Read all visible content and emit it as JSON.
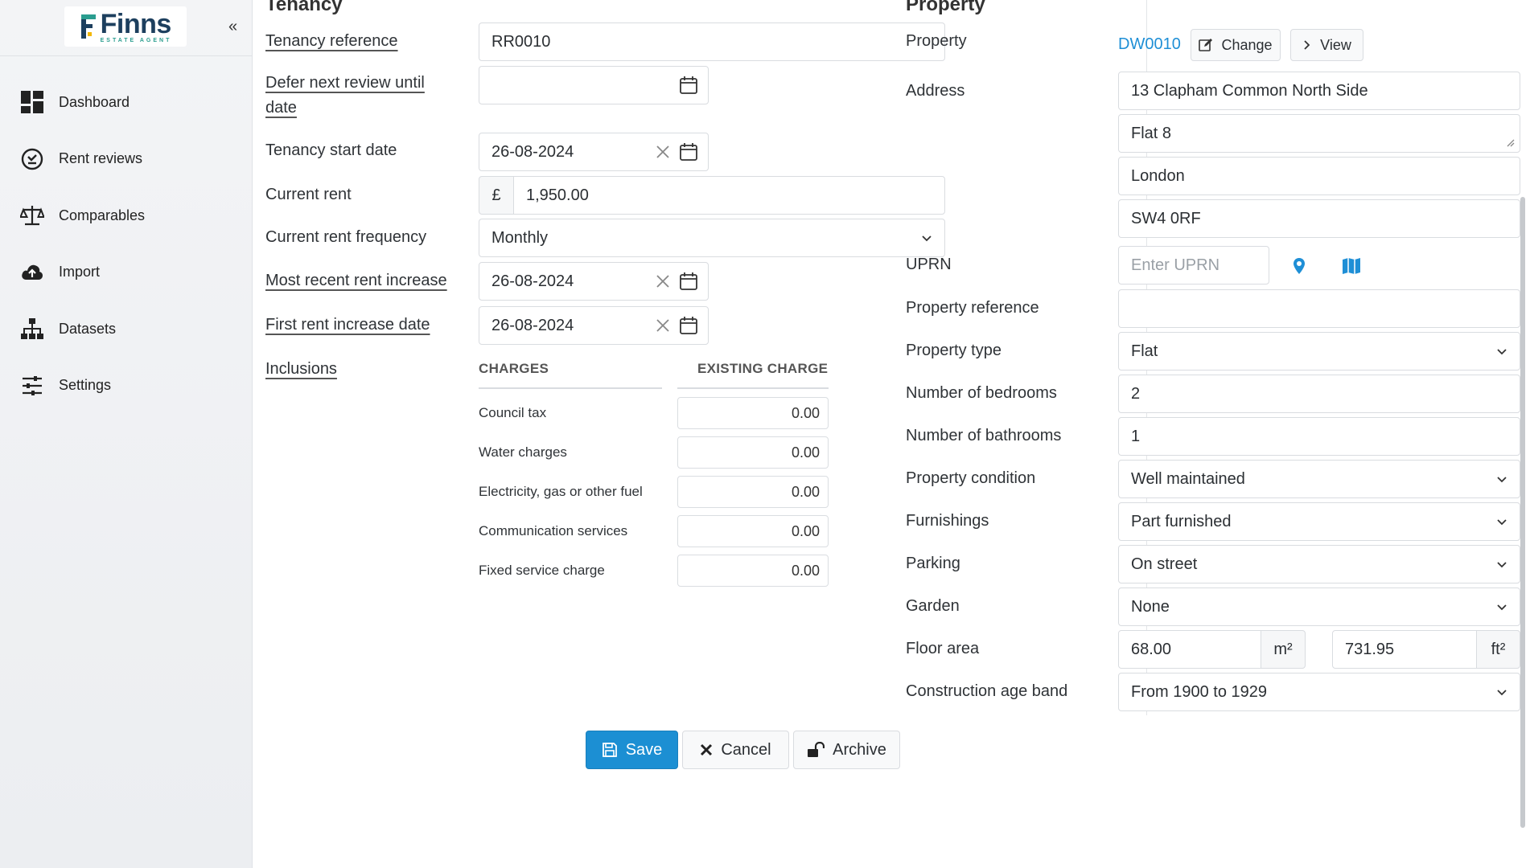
{
  "app": {
    "logo_text": "Finns",
    "logo_sub": "ESTATE AGENT",
    "collapse_label": "«"
  },
  "sidebar": {
    "items": [
      {
        "label": "Dashboard",
        "icon": "dashboard-icon"
      },
      {
        "label": "Rent reviews",
        "icon": "rent-reviews-icon"
      },
      {
        "label": "Comparables",
        "icon": "scales-icon"
      },
      {
        "label": "Import",
        "icon": "cloud-upload-icon"
      },
      {
        "label": "Datasets",
        "icon": "sitemap-icon"
      },
      {
        "label": "Settings",
        "icon": "sliders-icon"
      }
    ]
  },
  "tenancy": {
    "title": "Tenancy",
    "reference_label": "Tenancy reference",
    "reference_value": "RR0010",
    "defer_label_1": "Defer next review until",
    "defer_label_2": "date",
    "defer_value": "",
    "start_label": "Tenancy start date",
    "start_value": "26-08-2024",
    "rent_label": "Current rent",
    "rent_currency": "£",
    "rent_value": "1,950.00",
    "frequency_label": "Current rent frequency",
    "frequency_value": "Monthly",
    "recent_increase_label": "Most recent rent increase",
    "recent_increase_value": "26-08-2024",
    "first_increase_label": "First rent increase date",
    "first_increase_value": "26-08-2024",
    "inclusions_label": "Inclusions",
    "charges_header": "CHARGES",
    "existing_header": "EXISTING CHARGE",
    "charges": [
      {
        "label": "Council tax",
        "value": "0.00"
      },
      {
        "label": "Water charges",
        "value": "0.00"
      },
      {
        "label": "Electricity, gas or other fuel",
        "value": "0.00"
      },
      {
        "label": "Communication services",
        "value": "0.00"
      },
      {
        "label": "Fixed service charge",
        "value": "0.00"
      }
    ]
  },
  "property": {
    "title": "Property",
    "property_label": "Property",
    "property_link": "DW0010",
    "change_label": "Change",
    "view_label": "View",
    "address_label": "Address",
    "address_1": "13 Clapham Common North Side",
    "address_2": "Flat 8",
    "address_3": "London",
    "address_4": "SW4 0RF",
    "uprn_label": "UPRN",
    "uprn_placeholder": "Enter UPRN",
    "reference_label": "Property reference",
    "reference_value": "",
    "type_label": "Property type",
    "type_value": "Flat",
    "bedrooms_label": "Number of bedrooms",
    "bedrooms_value": "2",
    "bathrooms_label": "Number of bathrooms",
    "bathrooms_value": "1",
    "condition_label": "Property condition",
    "condition_value": "Well maintained",
    "furnishings_label": "Furnishings",
    "furnishings_value": "Part furnished",
    "parking_label": "Parking",
    "parking_value": "On street",
    "garden_label": "Garden",
    "garden_value": "None",
    "floor_area_label": "Floor area",
    "floor_area_m2": "68.00",
    "unit_m2": "m²",
    "floor_area_ft2": "731.95",
    "unit_ft2": "ft²",
    "age_band_label": "Construction age band",
    "age_band_value": "From 1900 to 1929"
  },
  "actions": {
    "save_label": "Save",
    "cancel_label": "Cancel",
    "archive_label": "Archive"
  },
  "colors": {
    "primary": "#1c8fd3",
    "link": "#1f8fd6",
    "logo_navy": "#1d3f5e",
    "logo_teal": "#2a9d8f"
  }
}
